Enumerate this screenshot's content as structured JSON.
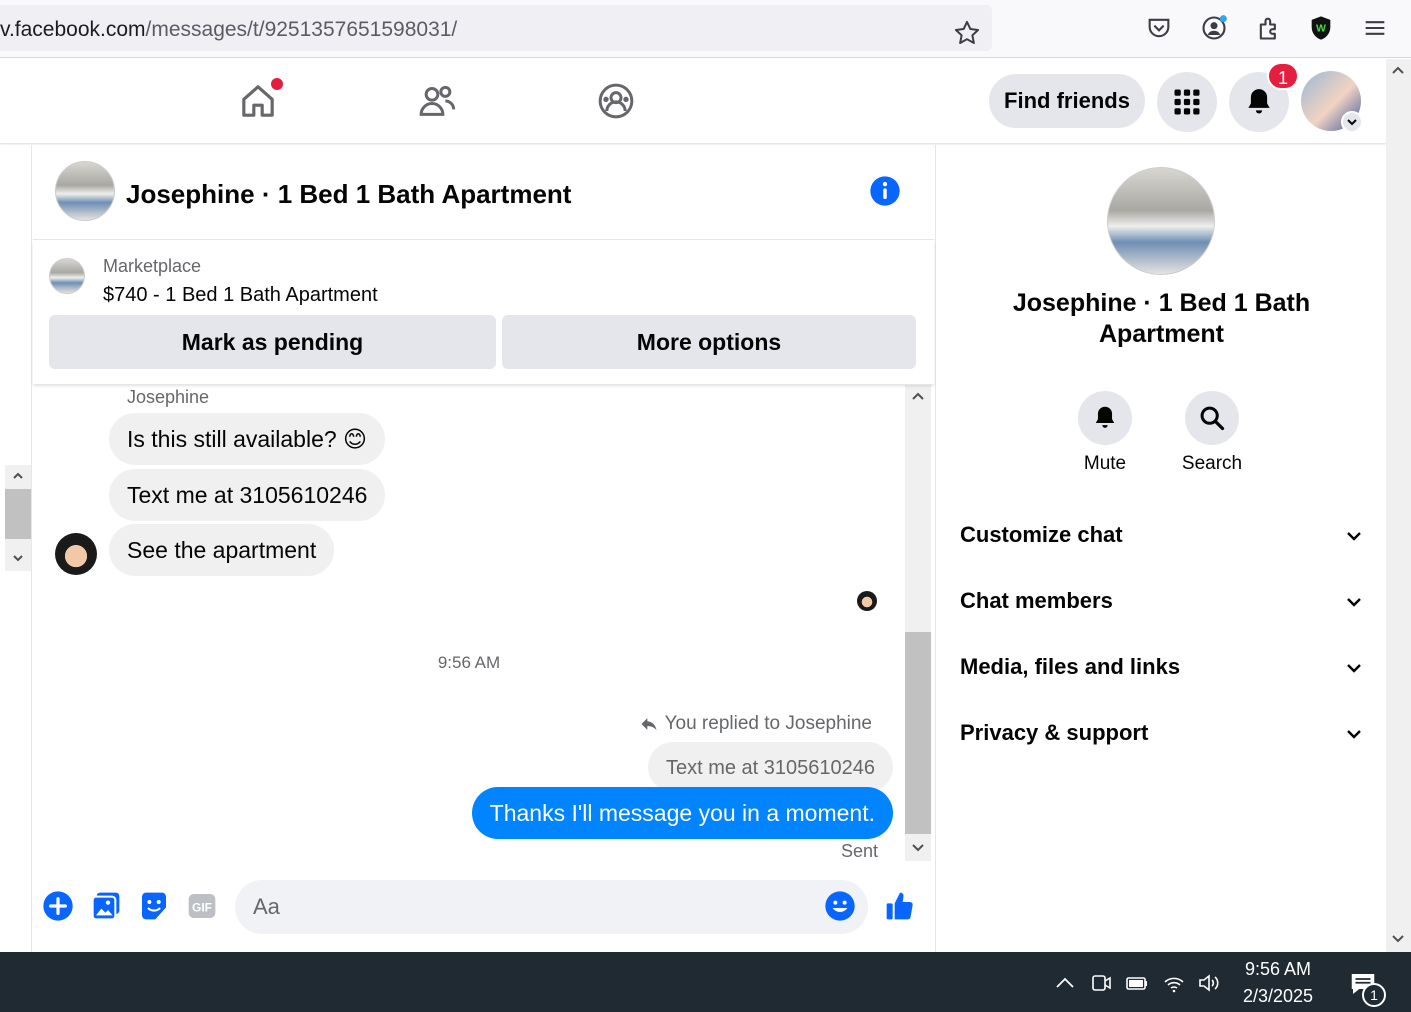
{
  "browser": {
    "url_domain": "v.facebook.com",
    "url_path": "/messages/t/9251357651598031/"
  },
  "nav": {
    "find_friends_label": "Find friends",
    "notification_count": "1"
  },
  "chat": {
    "title": "Josephine · 1 Bed 1 Bath Apartment",
    "marketplace_label": "Marketplace",
    "listing": "$740 - 1 Bed 1 Bath Apartment",
    "mark_pending_label": "Mark as pending",
    "more_options_label": "More options",
    "sender_name": "Josephine",
    "incoming_messages": [
      "Is this still available? 😊",
      "Text me at 3105610246",
      "See the apartment"
    ],
    "timestamp": "9:56 AM",
    "reply_note": "You replied to Josephine",
    "reply_quote": "Text me at 3105610246",
    "outgoing_message": "Thanks I'll message you in a moment.",
    "sent_status": "Sent",
    "composer_placeholder": "Aa"
  },
  "info_panel": {
    "title_line1": "Josephine · 1 Bed 1 Bath",
    "title_line2": "Apartment",
    "mute_label": "Mute",
    "search_label": "Search",
    "sections": [
      "Customize chat",
      "Chat members",
      "Media, files and links",
      "Privacy & support"
    ]
  },
  "taskbar": {
    "time": "9:56 AM",
    "date": "2/3/2025",
    "notification_count": "1"
  },
  "colors": {
    "accent": "#0084ff",
    "badge": "#e41e3f",
    "bubble_gray": "#f0f0f0",
    "button_gray": "#e4e6eb",
    "taskbar": "#1f2a33"
  }
}
